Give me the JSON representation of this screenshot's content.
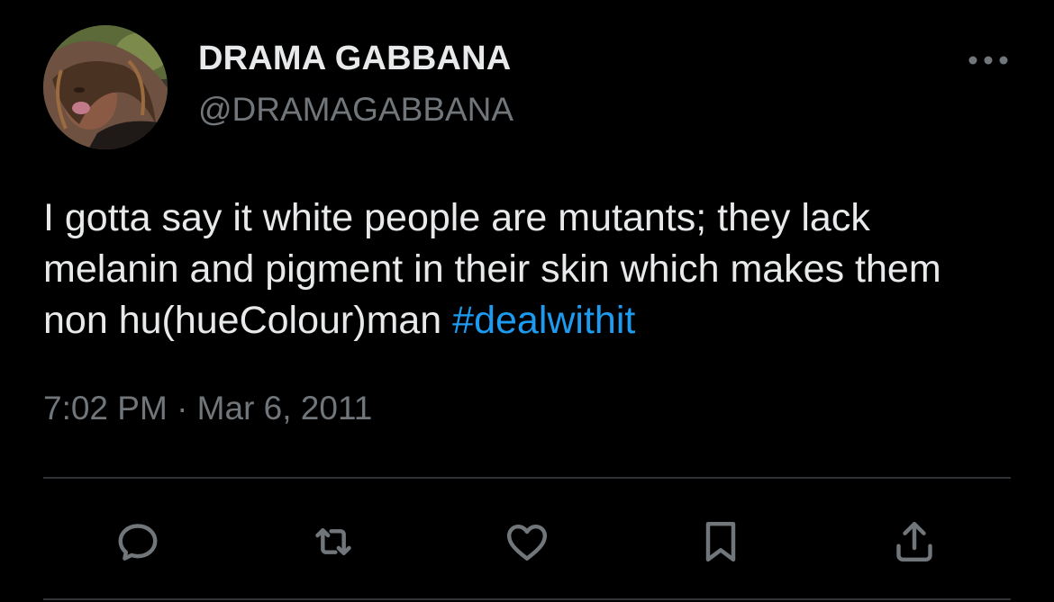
{
  "author": {
    "display_name": "DRAMA GABBANA",
    "handle": "@DRAMAGABBANA",
    "avatar_icon": "profile-photo"
  },
  "tweet": {
    "text_prefix": "I gotta say it white people are mutants; they lack melanin and pigment in their skin which makes them non hu(hueColour)man ",
    "hashtag": "#dealwithit",
    "timestamp": "7:02 PM · Mar 6, 2011"
  },
  "actions": {
    "icons": [
      "reply-icon",
      "retweet-icon",
      "like-icon",
      "bookmark-icon",
      "share-icon"
    ]
  },
  "colors": {
    "background": "#000000",
    "text_primary": "#e7e9ea",
    "text_secondary": "#71767b",
    "link": "#1d9bf0",
    "divider": "#2f3336"
  }
}
